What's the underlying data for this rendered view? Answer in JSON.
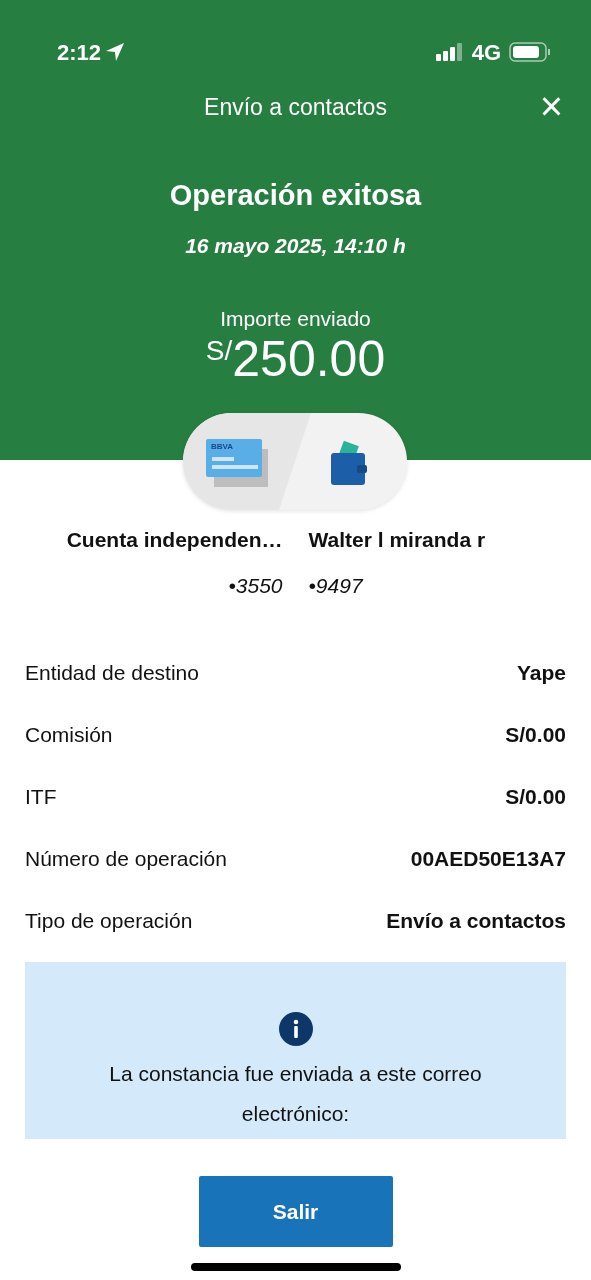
{
  "status_bar": {
    "time": "2:12",
    "network": "4G"
  },
  "header": {
    "title": "Envío a contactos",
    "close": "×"
  },
  "result": {
    "title": "Operación exitosa",
    "date": "16 mayo 2025, 14:10 h",
    "amount_label": "Importe enviado",
    "currency": "S/",
    "amount": "250.00"
  },
  "transfer": {
    "card_label": "BBVA",
    "parties": [
      {
        "name": "Cuenta independen…",
        "number": "•3550"
      },
      {
        "name": "Walter l miranda r",
        "number": "•9497"
      }
    ]
  },
  "details": [
    {
      "label": "Entidad de destino",
      "value": "Yape"
    },
    {
      "label": "Comisión",
      "value": "S/0.00"
    },
    {
      "label": "ITF",
      "value": "S/0.00"
    },
    {
      "label": "Número de operación",
      "value": "00AED50E13A7"
    },
    {
      "label": "Tipo de operación",
      "value": "Envío a contactos"
    }
  ],
  "notice": {
    "text": "La constancia fue enviada a este correo electrónico:"
  },
  "button": "Salir"
}
